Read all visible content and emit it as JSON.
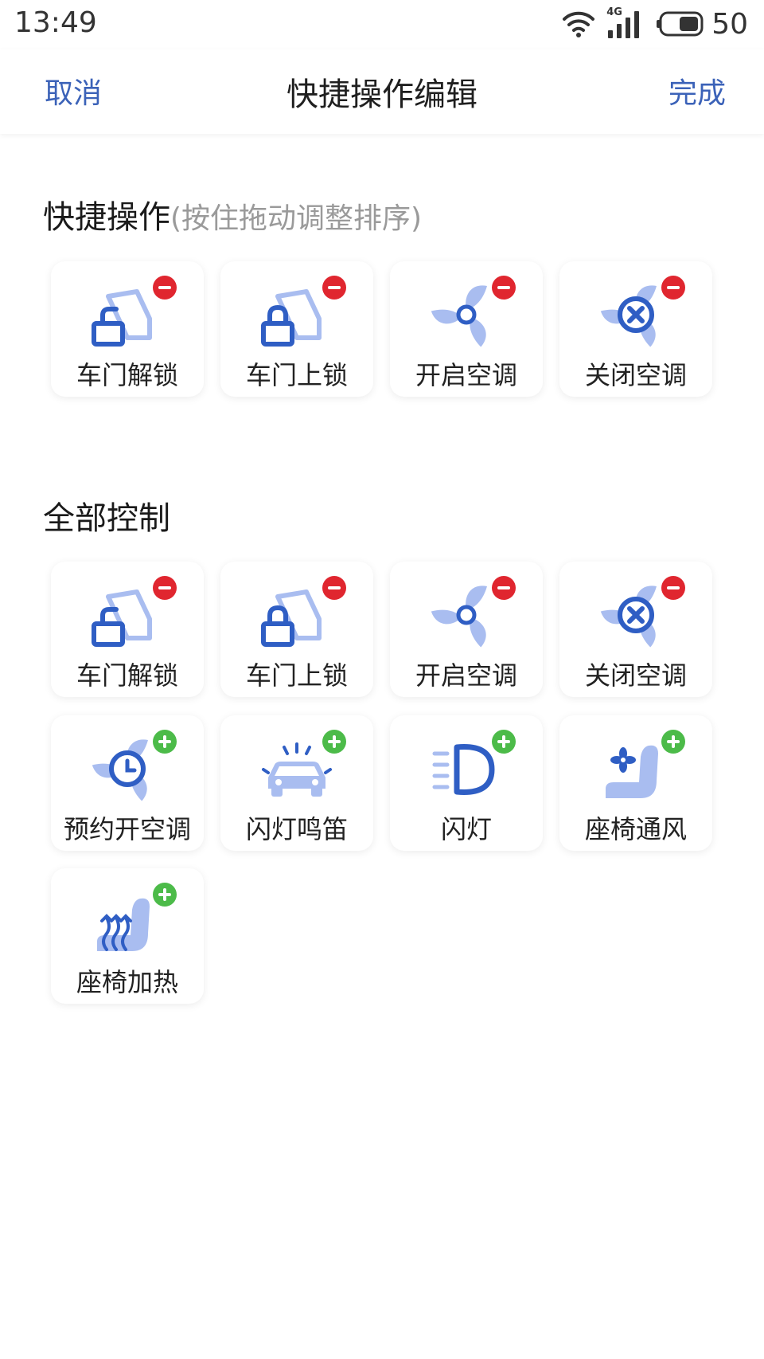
{
  "status_bar": {
    "time": "13:49",
    "network": "4G",
    "battery": "50",
    "icons": [
      "wifi-icon",
      "signal-icon",
      "battery-icon"
    ]
  },
  "nav": {
    "cancel": "取消",
    "title": "快捷操作编辑",
    "done": "完成"
  },
  "quick_section": {
    "title": "快捷操作",
    "hint": "(按住拖动调整排序)",
    "items": [
      {
        "label": "车门解锁",
        "icon": "door-unlock-icon",
        "badge": "remove"
      },
      {
        "label": "车门上锁",
        "icon": "door-lock-icon",
        "badge": "remove"
      },
      {
        "label": "开启空调",
        "icon": "fan-on-icon",
        "badge": "remove"
      },
      {
        "label": "关闭空调",
        "icon": "fan-off-icon",
        "badge": "remove"
      }
    ]
  },
  "all_section": {
    "title": "全部控制",
    "items": [
      {
        "label": "车门解锁",
        "icon": "door-unlock-icon",
        "badge": "remove"
      },
      {
        "label": "车门上锁",
        "icon": "door-lock-icon",
        "badge": "remove"
      },
      {
        "label": "开启空调",
        "icon": "fan-on-icon",
        "badge": "remove"
      },
      {
        "label": "关闭空调",
        "icon": "fan-off-icon",
        "badge": "remove"
      },
      {
        "label": "预约开空调",
        "icon": "fan-schedule-icon",
        "badge": "add"
      },
      {
        "label": "闪灯鸣笛",
        "icon": "car-flash-horn-icon",
        "badge": "add"
      },
      {
        "label": "闪灯",
        "icon": "headlight-icon",
        "badge": "add"
      },
      {
        "label": "座椅通风",
        "icon": "seat-ventilation-icon",
        "badge": "add"
      },
      {
        "label": "座椅加热",
        "icon": "seat-heating-icon",
        "badge": "add"
      }
    ]
  },
  "colors": {
    "accent": "#3b62b8",
    "icon_dark": "#2f5ec4",
    "icon_light": "#a9bdf0",
    "remove": "#e0262f",
    "add": "#4cbb49"
  }
}
